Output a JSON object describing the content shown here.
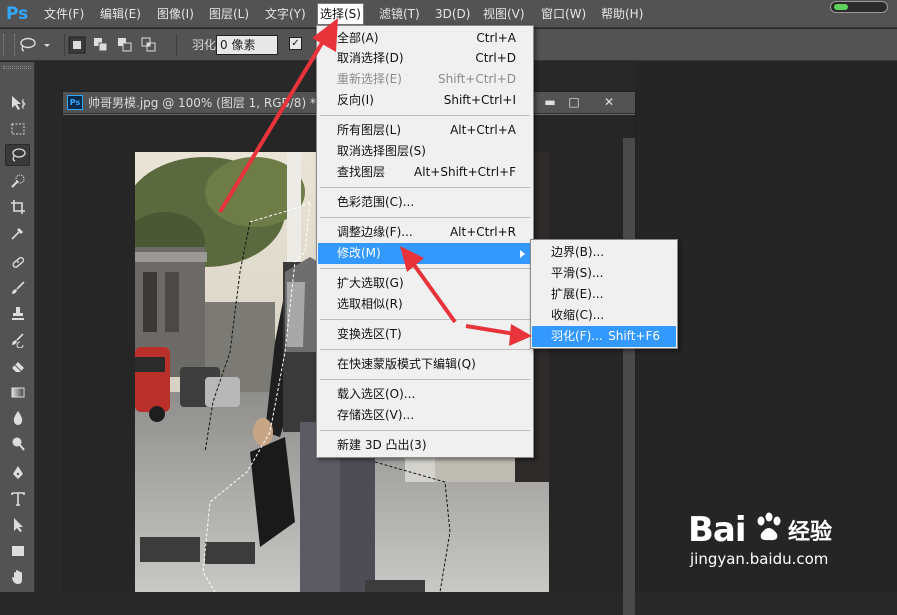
{
  "app": {
    "logo": "Ps"
  },
  "menubar": {
    "items": [
      {
        "label": "文件(F)"
      },
      {
        "label": "编辑(E)"
      },
      {
        "label": "图像(I)"
      },
      {
        "label": "图层(L)"
      },
      {
        "label": "文字(Y)"
      },
      {
        "label": "选择(S)"
      },
      {
        "label": "滤镜(T)"
      },
      {
        "label": "3D(D)"
      },
      {
        "label": "视图(V)"
      },
      {
        "label": "窗口(W)"
      },
      {
        "label": "帮助(H)"
      }
    ],
    "active_menu": "选择(S)"
  },
  "options": {
    "feather_label": "羽化:",
    "feather_value": "0 像素",
    "antialias_checked": true,
    "tool_icon": "lasso-icon",
    "selection_mode_icons": [
      "new-selection-icon",
      "add-selection-icon",
      "subtract-selection-icon",
      "intersect-selection-icon"
    ]
  },
  "tools": [
    {
      "icon": "move-icon"
    },
    {
      "icon": "marquee-icon"
    },
    {
      "icon": "lasso-icon",
      "selected": true
    },
    {
      "icon": "quick-select-icon"
    },
    {
      "icon": "crop-icon"
    },
    {
      "icon": "eyedropper-icon"
    },
    {
      "icon": "healing-brush-icon"
    },
    {
      "icon": "brush-icon"
    },
    {
      "icon": "clone-stamp-icon"
    },
    {
      "icon": "history-brush-icon"
    },
    {
      "icon": "eraser-icon"
    },
    {
      "icon": "gradient-icon"
    },
    {
      "icon": "blur-icon"
    },
    {
      "icon": "dodge-icon"
    },
    {
      "icon": "pen-icon"
    },
    {
      "icon": "type-icon"
    },
    {
      "icon": "path-select-icon"
    },
    {
      "icon": "rectangle-icon"
    },
    {
      "icon": "hand-icon"
    }
  ],
  "document": {
    "title": "帅哥男模.jpg @ 100% (图层 1, RGB/8) *",
    "window_buttons": [
      "minimize",
      "restore",
      "close"
    ]
  },
  "select_menu": {
    "groups": [
      [
        {
          "label": "全部(A)",
          "shortcut": "Ctrl+A"
        },
        {
          "label": "取消选择(D)",
          "shortcut": "Ctrl+D"
        },
        {
          "label": "重新选择(E)",
          "shortcut": "Shift+Ctrl+D",
          "disabled": true
        },
        {
          "label": "反向(I)",
          "shortcut": "Shift+Ctrl+I"
        }
      ],
      [
        {
          "label": "所有图层(L)",
          "shortcut": "Alt+Ctrl+A"
        },
        {
          "label": "取消选择图层(S)",
          "shortcut": ""
        },
        {
          "label": "查找图层",
          "shortcut": "Alt+Shift+Ctrl+F"
        }
      ],
      [
        {
          "label": "色彩范围(C)...",
          "shortcut": ""
        }
      ],
      [
        {
          "label": "调整边缘(F)...",
          "shortcut": "Alt+Ctrl+R"
        },
        {
          "label": "修改(M)",
          "shortcut": "",
          "highlighted": true,
          "submenu": true
        }
      ],
      [
        {
          "label": "扩大选取(G)",
          "shortcut": ""
        },
        {
          "label": "选取相似(R)",
          "shortcut": ""
        }
      ],
      [
        {
          "label": "变换选区(T)",
          "shortcut": ""
        }
      ],
      [
        {
          "label": "在快速蒙版模式下编辑(Q)",
          "shortcut": ""
        }
      ],
      [
        {
          "label": "载入选区(O)...",
          "shortcut": ""
        },
        {
          "label": "存储选区(V)...",
          "shortcut": ""
        }
      ],
      [
        {
          "label": "新建 3D 凸出(3)",
          "shortcut": ""
        }
      ]
    ]
  },
  "modify_menu": {
    "items": [
      {
        "label": "边界(B)...",
        "shortcut": ""
      },
      {
        "label": "平滑(S)...",
        "shortcut": ""
      },
      {
        "label": "扩展(E)...",
        "shortcut": ""
      },
      {
        "label": "收缩(C)...",
        "shortcut": ""
      },
      {
        "label": "羽化(F)...",
        "shortcut": "Shift+F6",
        "highlighted": true
      }
    ]
  },
  "watermark": {
    "brand": "Bai",
    "brand_suffix": "经验",
    "url": "jingyan.baidu.com"
  },
  "colors": {
    "accent_highlight": "#3399ff",
    "annotation_arrow": "#e8333a",
    "ps_blue": "#31a8ff"
  }
}
